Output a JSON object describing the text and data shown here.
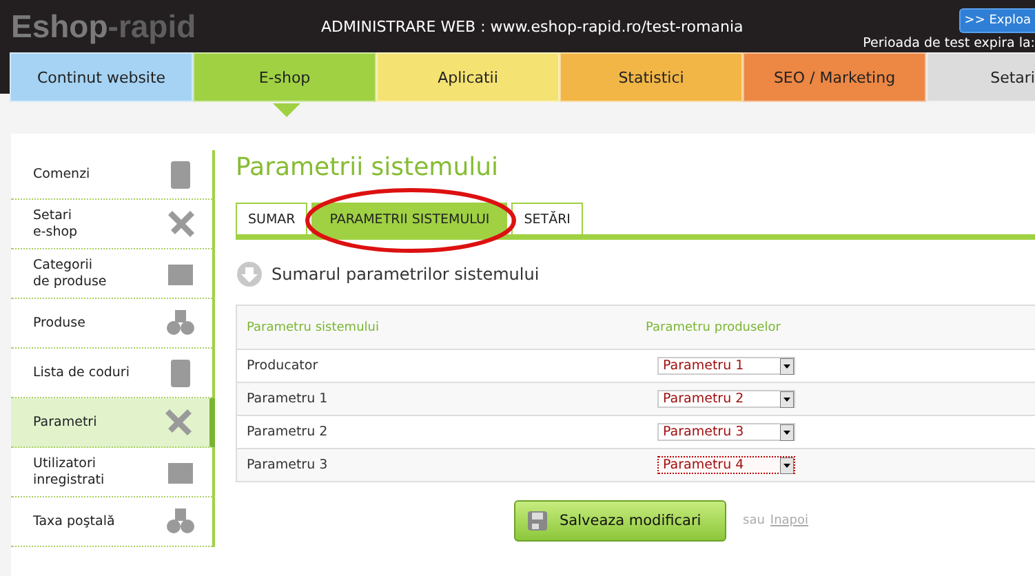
{
  "header": {
    "logo": {
      "part1": "Eshop",
      "part2": "-rapid"
    },
    "title": "ADMINISTRARE WEB : www.eshop-rapid.ro/test-romania",
    "explore_button": ">> Exploa",
    "trial_text": "Perioada de test expira la:"
  },
  "nav": [
    {
      "label": "Continut website",
      "color": "#a6d3f3",
      "selected": false
    },
    {
      "label": "E-shop",
      "color": "#9fd143",
      "selected": true
    },
    {
      "label": "Aplicatii",
      "color": "#f4e272",
      "selected": false
    },
    {
      "label": "Statistici",
      "color": "#f1b645",
      "selected": false
    },
    {
      "label": "SEO / Marketing",
      "color": "#ec8744",
      "selected": false
    },
    {
      "label": "Setari",
      "color": "#dcdcdc",
      "selected": false
    }
  ],
  "sidebar": {
    "items": [
      {
        "label": "Comenzi",
        "selected": false
      },
      {
        "label": "Setari\ne-shop",
        "selected": false
      },
      {
        "label": "Categorii\nde produse",
        "selected": false
      },
      {
        "label": "Produse",
        "selected": false
      },
      {
        "label": "Lista de coduri",
        "selected": false
      },
      {
        "label": "Parametri",
        "selected": true
      },
      {
        "label": "Utilizatori\ninregistrati",
        "selected": false
      },
      {
        "label": "Taxa poştală",
        "selected": false
      }
    ]
  },
  "page_title": "Parametrii sistemului",
  "tabs": [
    {
      "label": "SUMAR",
      "selected": false
    },
    {
      "label": "PARAMETRII SISTEMULUI",
      "selected": true
    },
    {
      "label": "SETĂRI",
      "selected": false
    }
  ],
  "section_title": "Sumarul parametrilor sistemului",
  "table": {
    "columns": [
      "Parametru sistemului",
      "Parametru produselor"
    ],
    "rows": [
      {
        "name": "Producator",
        "value": "Parametru 1",
        "focused": false
      },
      {
        "name": "Parametru 1",
        "value": "Parametru 2",
        "focused": false
      },
      {
        "name": "Parametru 2",
        "value": "Parametru 3",
        "focused": false
      },
      {
        "name": "Parametru 3",
        "value": "Parametru 4",
        "focused": true
      }
    ]
  },
  "save_button": "Salveaza modificari",
  "or_text": "sau",
  "back_link": "Inapoi"
}
